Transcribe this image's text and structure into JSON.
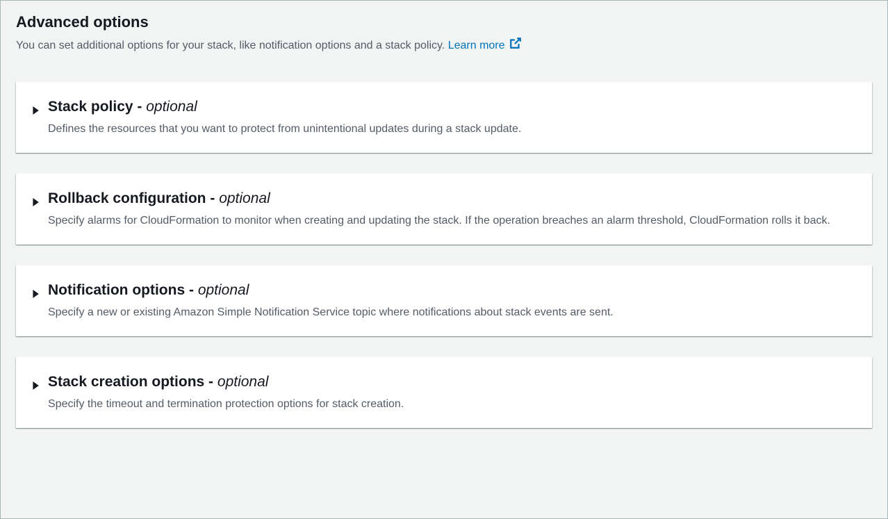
{
  "header": {
    "title": "Advanced options",
    "subtitle": "You can set additional options for your stack, like notification options and a stack policy.",
    "learn_more": "Learn more"
  },
  "sections": [
    {
      "title": "Stack policy",
      "dash": " - ",
      "optional": "optional",
      "description": "Defines the resources that you want to protect from unintentional updates during a stack update."
    },
    {
      "title": "Rollback configuration",
      "dash": " - ",
      "optional": "optional",
      "description": "Specify alarms for CloudFormation to monitor when creating and updating the stack. If the operation breaches an alarm threshold, CloudFormation rolls it back."
    },
    {
      "title": "Notification options",
      "dash": " - ",
      "optional": "optional",
      "description": "Specify a new or existing Amazon Simple Notification Service topic where notifications about stack events are sent."
    },
    {
      "title": "Stack creation options",
      "dash": " - ",
      "optional": "optional",
      "description": "Specify the timeout and termination protection options for stack creation."
    }
  ]
}
